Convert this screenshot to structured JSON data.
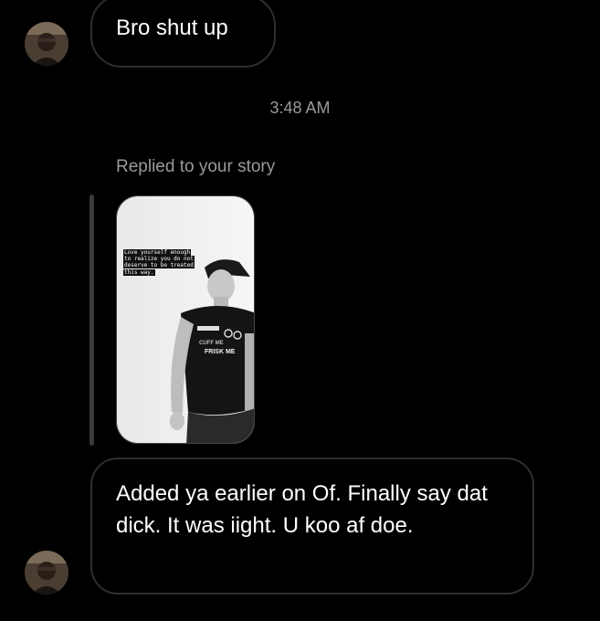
{
  "messages": {
    "first": {
      "text": "Bro shut up"
    },
    "timestamp": "3:48 AM",
    "reply": {
      "label": "Replied to your story",
      "story_caption_lines": [
        "Love yourself enough",
        "to realize you do not",
        "deserve to be treated",
        "this way."
      ],
      "shirt_text_top": "CUFF",
      "shirt_text_mid": "CUFF ME",
      "shirt_text_bottom": "FRISK ME"
    },
    "second": {
      "text": "Added ya earlier on Of. Finally say dat dick. It was iight. U koo af doe."
    }
  },
  "colors": {
    "background": "#000000",
    "bubble_border": "#2e2e2e",
    "muted_text": "#9a9a9a"
  }
}
